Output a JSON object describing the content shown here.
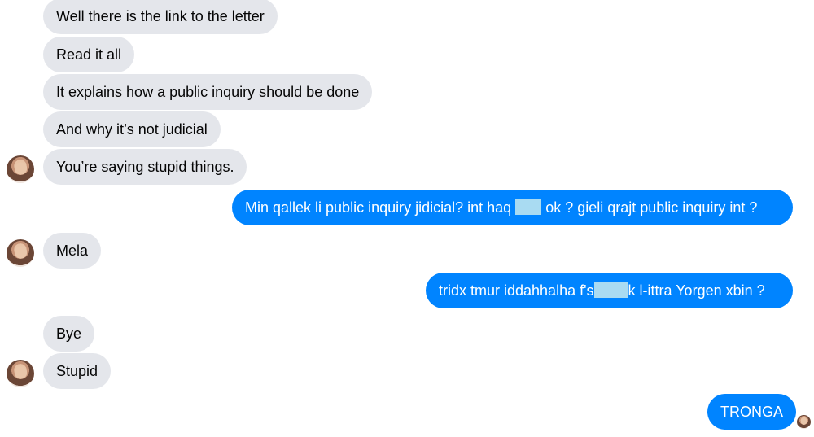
{
  "conversation": {
    "messages": [
      {
        "sender": "other",
        "text": "Well there is the link to the letter"
      },
      {
        "sender": "other",
        "text": "Read it all"
      },
      {
        "sender": "other",
        "text": "It explains how a public inquiry should be done"
      },
      {
        "sender": "other",
        "text": "And why it’s not judicial"
      },
      {
        "sender": "other",
        "text": "You’re saying stupid things."
      },
      {
        "sender": "me",
        "text_before": "Min qallek li public inquiry jidicial? int haq",
        "text_after": "ok ? gieli qrajt public inquiry int ?"
      },
      {
        "sender": "other",
        "text": "Mela"
      },
      {
        "sender": "me",
        "text_before": "tridx tmur iddahhalha f's",
        "text_after": "k l-ittra Yorgen xbin ?"
      },
      {
        "sender": "other",
        "text": "Bye"
      },
      {
        "sender": "other",
        "text": "Stupid"
      },
      {
        "sender": "me",
        "text": "TRONGA"
      }
    ]
  },
  "colors": {
    "incoming_bubble": "#e4e6eb",
    "outgoing_bubble": "#0084ff",
    "redaction": "#a9dbf2"
  }
}
